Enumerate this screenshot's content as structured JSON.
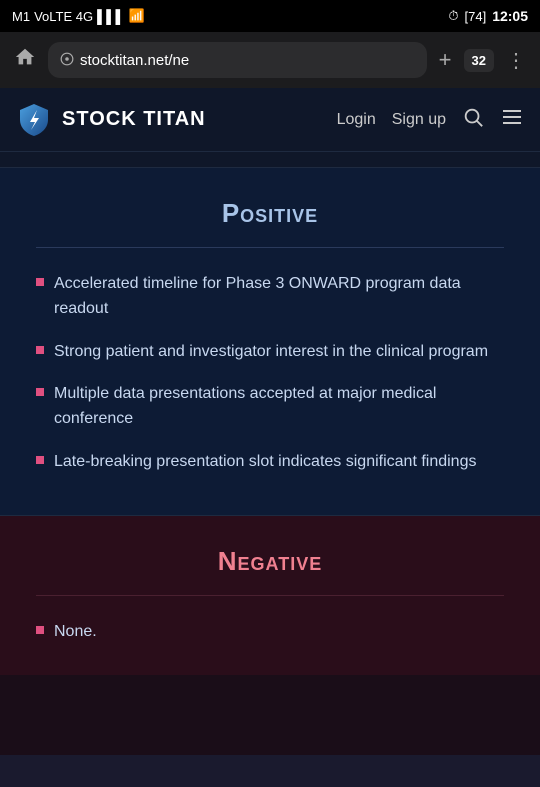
{
  "statusBar": {
    "carrier": "M1",
    "network": "VoLTE 4G",
    "signal": "●●●●",
    "wifi": "WiFi",
    "alarm": "⏰",
    "battery": "74",
    "time": "12:05"
  },
  "browserBar": {
    "urlDisplay": "stocktitan.net/ne",
    "tabsCount": "32",
    "addTabLabel": "+",
    "menuLabel": "⋮",
    "homeLabel": "⌂"
  },
  "siteHeader": {
    "logoText": "STOCK TITAN",
    "loginLabel": "Login",
    "signupLabel": "Sign up"
  },
  "positiveSection": {
    "title": "Positive",
    "divider": true,
    "bullets": [
      "Accelerated timeline for Phase 3 ONWARD program data readout",
      "Strong patient and investigator interest in the clinical program",
      "Multiple data presentations accepted at major medical conference",
      "Late-breaking presentation slot indicates significant findings"
    ]
  },
  "negativeSection": {
    "title": "Negative",
    "divider": true,
    "bullets": [
      "None."
    ]
  }
}
